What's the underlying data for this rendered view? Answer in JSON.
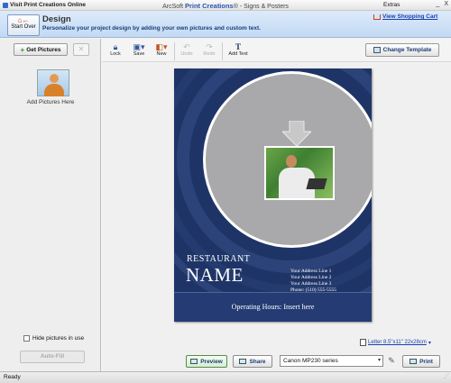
{
  "titlebar": {
    "visit_link": "Visit Print Creations Online",
    "app_prefix": "ArcSoft",
    "app_brand": "Print Creations",
    "app_suffix": "® - Signs & Posters",
    "extras": "Extras",
    "minimize": "_",
    "close": "X"
  },
  "header": {
    "start_over": "Start Over",
    "title": "Design",
    "subtitle": "Personalize your project design by adding your own pictures and custom text.",
    "cart_link": "View Shopping Cart"
  },
  "left_panel": {
    "get_pictures": "Get Pictures",
    "add_pictures_label": "Add Pictures Here",
    "hide_pictures_label": "Hide pictures in use",
    "hide_pictures_checked": false,
    "auto_fill": "Auto-Fill"
  },
  "toolbar": {
    "lock": "Lock",
    "save": "Save",
    "new": "New",
    "undo": "Undo",
    "redo": "Redo",
    "add_text": "Add Text",
    "change_template": "Change Template"
  },
  "poster": {
    "heading": "RESTAURANT",
    "name": "NAME",
    "address_lines": [
      "Your Address Line 1",
      "Your Address Line 2",
      "Your Address Line 3",
      "Phone: (510) 555-5555"
    ],
    "hours": "Operating Hours: Insert here"
  },
  "paper_size": "Letter 8.5\"x11\" 22x28cm",
  "bottom_bar": {
    "preview": "Preview",
    "share": "Share",
    "printer": "Canon MP230 series",
    "print": "Print"
  },
  "status": "Ready",
  "colors": {
    "poster_bg": "#1f3466",
    "circle": "#a9a9ab",
    "header_bg": "#c3d9f3",
    "link": "#1a3fb0"
  }
}
